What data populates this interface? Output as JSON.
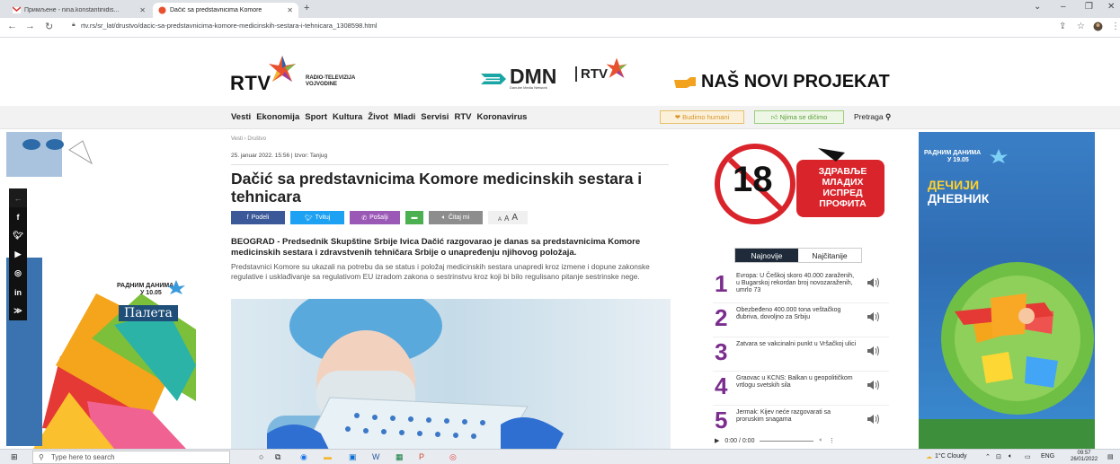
{
  "browser": {
    "tabs": [
      {
        "title": "Примљене - nina.konstantinidis..."
      },
      {
        "title": "Dačić sa predstavnicima Komore"
      }
    ],
    "url": "rtv.rs/sr_lat/drustvo/dacic-sa-predstavnicima-komore-medicinskih-sestara-i-tehnicara_1308598.html"
  },
  "header": {
    "rtv": "RTV",
    "rtv_sub_1": "RADIO-TELEVIZIJA",
    "rtv_sub_2": "VOJVODINE",
    "dmn": "DMN",
    "dmn_sub": "Danube Media Network",
    "dmn_rtv": "RTV",
    "projekat": "NAŠ NOVI PROJEKAT"
  },
  "nav": {
    "links": [
      "Vesti",
      "Ekonomija",
      "Sport",
      "Kultura",
      "Život",
      "Mladi",
      "Servisi",
      "RTV",
      "Koronavirus"
    ],
    "budimo": "Budimo humani",
    "njima": "Njima se dičimo",
    "pretraga": "Pretraga"
  },
  "ad_left": {
    "radnim_1": "РАДНИМ ДАНИМА",
    "radnim_2": "У 10.05",
    "paleta": "Палета"
  },
  "article": {
    "breadcrumb": "Vesti › Društvo",
    "meta": "25. januar 2022. 15:56 | Izvor: Tanjug",
    "headline": "Dačić sa predstavnicima Komore medicinskih sestara i tehnicara",
    "share": {
      "fb": "Podeli",
      "tw": "Tvituj",
      "po": "Pošalji",
      "ct": "Čitaj mi"
    },
    "lead": "BEOGRAD - Predsednik Skupštine Srbije Ivica Dačić razgovarao je danas sa predstavnicima Komore medicinskih sestara i zdravstvenih tehničara Srbije o unapređenju njihovog položaja.",
    "body": "Predstavnici Komore su ukazali na potrebu da se status i položaj medicinskih sestara unapredi kroz izmene i dopune zakonske regulative i usklađivanje sa regulativom EU izradom zakona o sestrinstvu kroz koji bi bilo regulisano pitanje sestrinske nege."
  },
  "campaign": {
    "number": "18",
    "line1": "ЗДРАВЉЕ",
    "line2": "МЛАДИХ",
    "line3": "ИСПРЕД",
    "line4": "ПРОФИТА"
  },
  "sidebar": {
    "tab_active": "Najnovije",
    "tab_inactive": "Najčitanije",
    "items": [
      {
        "num": "1",
        "text": "Evropa: U Češkoj skoro 40.000 zaraženih, u Bugarskoj rekordan broj novozaraženih, umrlo 73"
      },
      {
        "num": "2",
        "text": "Obezbeđeno 400.000 tona veštačkog đubriva, dovoljno za Srbiju"
      },
      {
        "num": "3",
        "text": "Zatvara se vakcinalni punkt u Vršačkoj ulici"
      },
      {
        "num": "4",
        "text": "Graovac u KCNS: Balkan u geopolitičkom vrtlogu svetskih sila"
      },
      {
        "num": "5",
        "text": "Jermak: Kijev neće razgovarati sa proruskim snagama"
      }
    ],
    "audio_time": "0:00 / 0:00"
  },
  "ad_right": {
    "radnim_1": "РАДНИМ ДАНИМА",
    "radnim_2": "У 19.05",
    "dec": "ДЕЧИЈИ",
    "dnevnik": "ДНЕВНИК"
  },
  "taskbar": {
    "search_placeholder": "Type here to search",
    "weather": "1°C  Cloudy",
    "lang": "ENG",
    "time": "09:57",
    "date": "26/01/2022"
  },
  "colors": {
    "number": "#7b2d8e",
    "fb": "#3b5998",
    "tw": "#1da1f2",
    "campaign_red": "#d9242b"
  }
}
